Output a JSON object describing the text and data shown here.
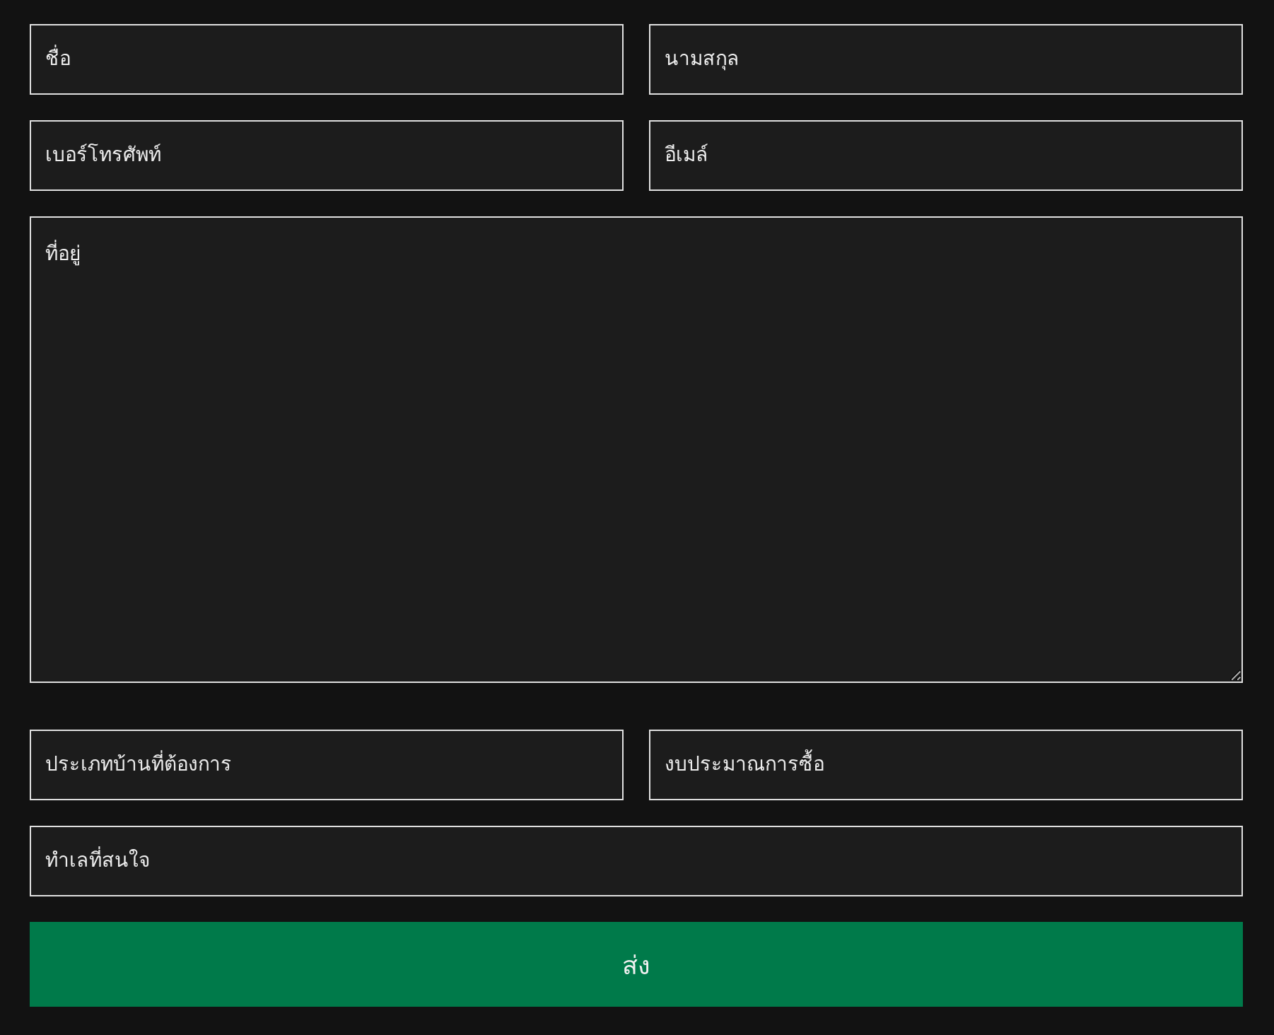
{
  "rows": [
    {
      "fields": [
        {
          "kind": "input",
          "placeholder": "ชื่อ"
        },
        {
          "kind": "input",
          "placeholder": "นามสกุล"
        }
      ]
    },
    {
      "fields": [
        {
          "kind": "input",
          "placeholder": "เบอร์โทรศัพท์"
        },
        {
          "kind": "input",
          "placeholder": "อีเมล์"
        }
      ]
    },
    {
      "fields": [
        {
          "kind": "textarea",
          "placeholder": "ที่อยู่"
        }
      ]
    },
    {
      "fields": [
        {
          "kind": "input",
          "placeholder": "ประเภทบ้านที่ต้องการ"
        },
        {
          "kind": "input",
          "placeholder": "งบประมาณการซื้อ"
        }
      ]
    },
    {
      "fields": [
        {
          "kind": "input",
          "placeholder": "ทำเลที่สนใจ"
        }
      ]
    }
  ],
  "submit": {
    "label": "ส่ง"
  }
}
